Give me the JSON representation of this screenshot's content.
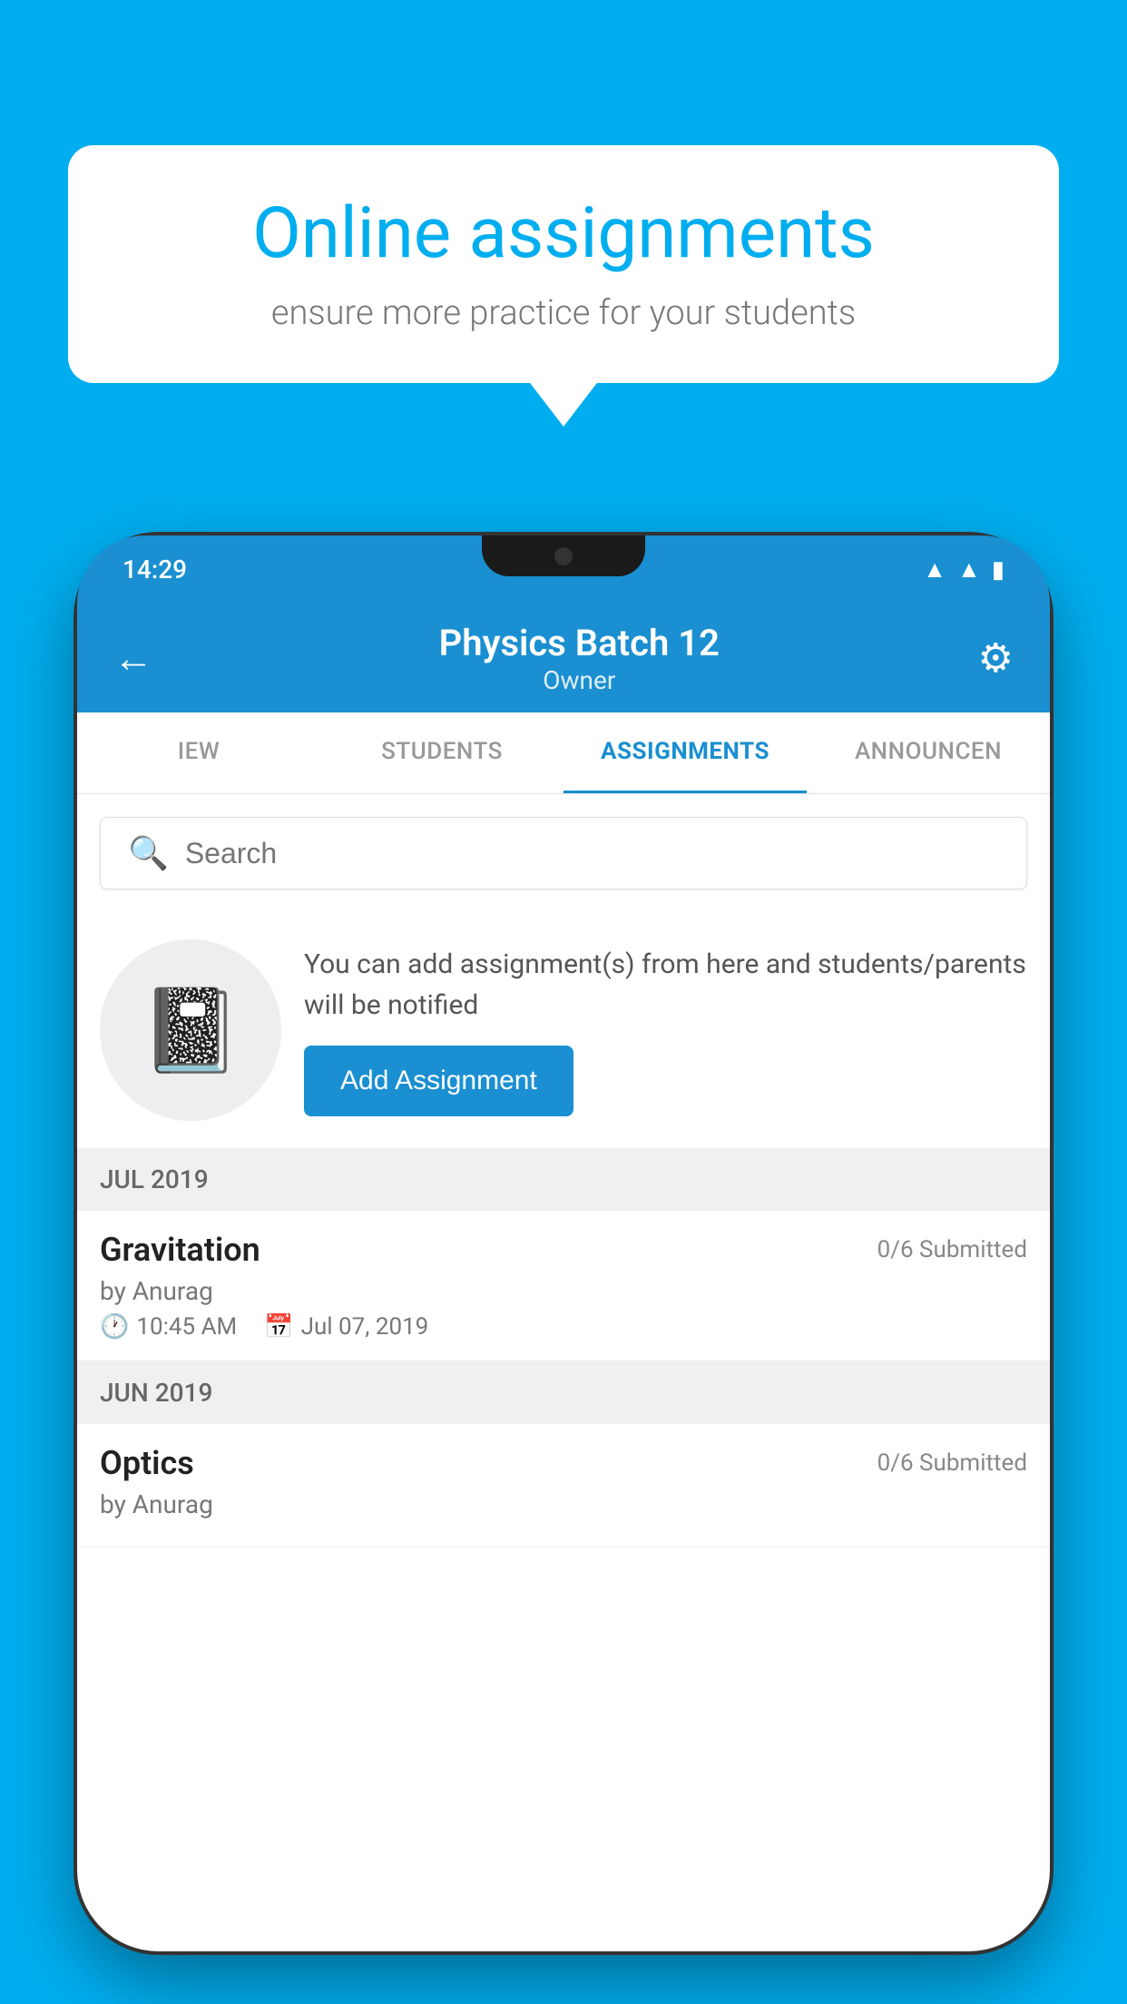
{
  "background_color": "#00AEEF",
  "speech_bubble": {
    "heading": "Online assignments",
    "subtext": "ensure more practice for your students"
  },
  "phone": {
    "status_bar": {
      "time": "14:29",
      "icons": [
        "wifi",
        "signal",
        "battery"
      ]
    },
    "app_bar": {
      "back_label": "←",
      "title": "Physics Batch 12",
      "subtitle": "Owner",
      "settings_label": "⚙"
    },
    "tabs": [
      {
        "label": "IEW",
        "active": false
      },
      {
        "label": "STUDENTS",
        "active": false
      },
      {
        "label": "ASSIGNMENTS",
        "active": true
      },
      {
        "label": "ANNOUNCEN",
        "active": false
      }
    ],
    "search": {
      "placeholder": "Search",
      "icon": "🔍"
    },
    "cta": {
      "description": "You can add assignment(s) from here and students/parents will be notified",
      "button_label": "Add Assignment",
      "icon": "📓"
    },
    "section_jul": "JUL 2019",
    "assignments_jul": [
      {
        "name": "Gravitation",
        "submitted": "0/6 Submitted",
        "by": "by Anurag",
        "time": "10:45 AM",
        "date": "Jul 07, 2019"
      }
    ],
    "section_jun": "JUN 2019",
    "assignments_jun": [
      {
        "name": "Optics",
        "submitted": "0/6 Submitted",
        "by": "by Anurag"
      }
    ]
  }
}
